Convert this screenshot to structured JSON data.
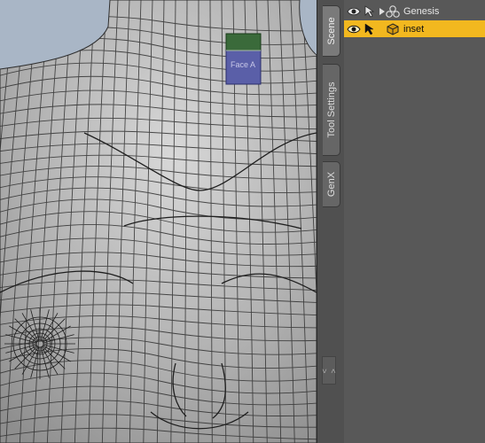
{
  "viewport": {
    "label": "3D viewport with wireframe figure",
    "widget_text": "Face A"
  },
  "tabs": [
    {
      "label": "Scene",
      "active": true
    },
    {
      "label": "Tool Settings",
      "active": false
    },
    {
      "label": "GenX",
      "active": false
    }
  ],
  "collapse_handle": "< >",
  "scene": {
    "nodes": [
      {
        "name": "Genesis",
        "selected": false,
        "icon": "figure-icon",
        "has_children": true
      },
      {
        "name": "inset",
        "selected": true,
        "icon": "primitive-cube-icon",
        "has_children": false
      }
    ]
  },
  "colors": {
    "selection": "#f2b81f",
    "panel_bg": "#585858",
    "viewport_bg": "#a9b6c6",
    "mesh_fill": "#b4b4b4",
    "wire": "#2f2f2f"
  }
}
